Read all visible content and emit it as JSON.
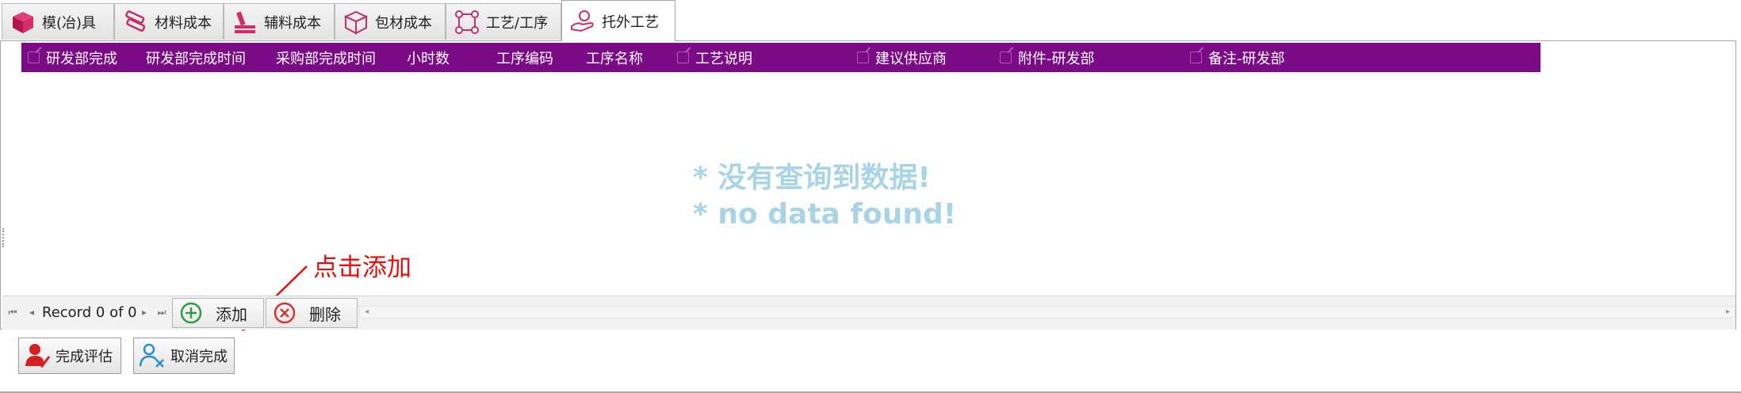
{
  "tabs": [
    {
      "label": "模(冶)具",
      "icon": "cube-icon"
    },
    {
      "label": "材料成本",
      "icon": "material-bars-icon"
    },
    {
      "label": "辅料成本",
      "icon": "auxiliary-material-icon"
    },
    {
      "label": "包材成本",
      "icon": "package-box-icon"
    },
    {
      "label": "工艺/工序",
      "icon": "process-nodes-icon"
    },
    {
      "label": "托外工艺",
      "icon": "outsource-hand-icon",
      "active": true
    }
  ],
  "grid": {
    "columns": [
      {
        "label": "研发部完成",
        "editable": true
      },
      {
        "label": "研发部完成时间",
        "editable": false
      },
      {
        "label": "采购部完成时间",
        "editable": false
      },
      {
        "label": "小时数",
        "editable": false
      },
      {
        "label": "工序编码",
        "editable": false
      },
      {
        "label": "工序名称",
        "editable": false
      },
      {
        "label": "工艺说明",
        "editable": true
      },
      {
        "label": "建议供应商",
        "editable": true
      },
      {
        "label": "附件-研发部",
        "editable": true
      },
      {
        "label": "备注-研发部",
        "editable": true
      }
    ],
    "empty_message": {
      "zh": "* 没有查询到数据!",
      "en": "* no data found!"
    }
  },
  "annotation": {
    "text": "点击添加"
  },
  "navigator": {
    "record_text": "Record 0 of 0",
    "add_label": "添加",
    "delete_label": "删除"
  },
  "actions": {
    "complete_label": "完成评估",
    "cancel_label": "取消完成"
  },
  "colors": {
    "header_bg": "#7a0a85",
    "empty_text": "#a9d4e6",
    "annotation": "#e01010",
    "add_icon": "#2e9b3f",
    "delete_icon": "#d93030"
  }
}
